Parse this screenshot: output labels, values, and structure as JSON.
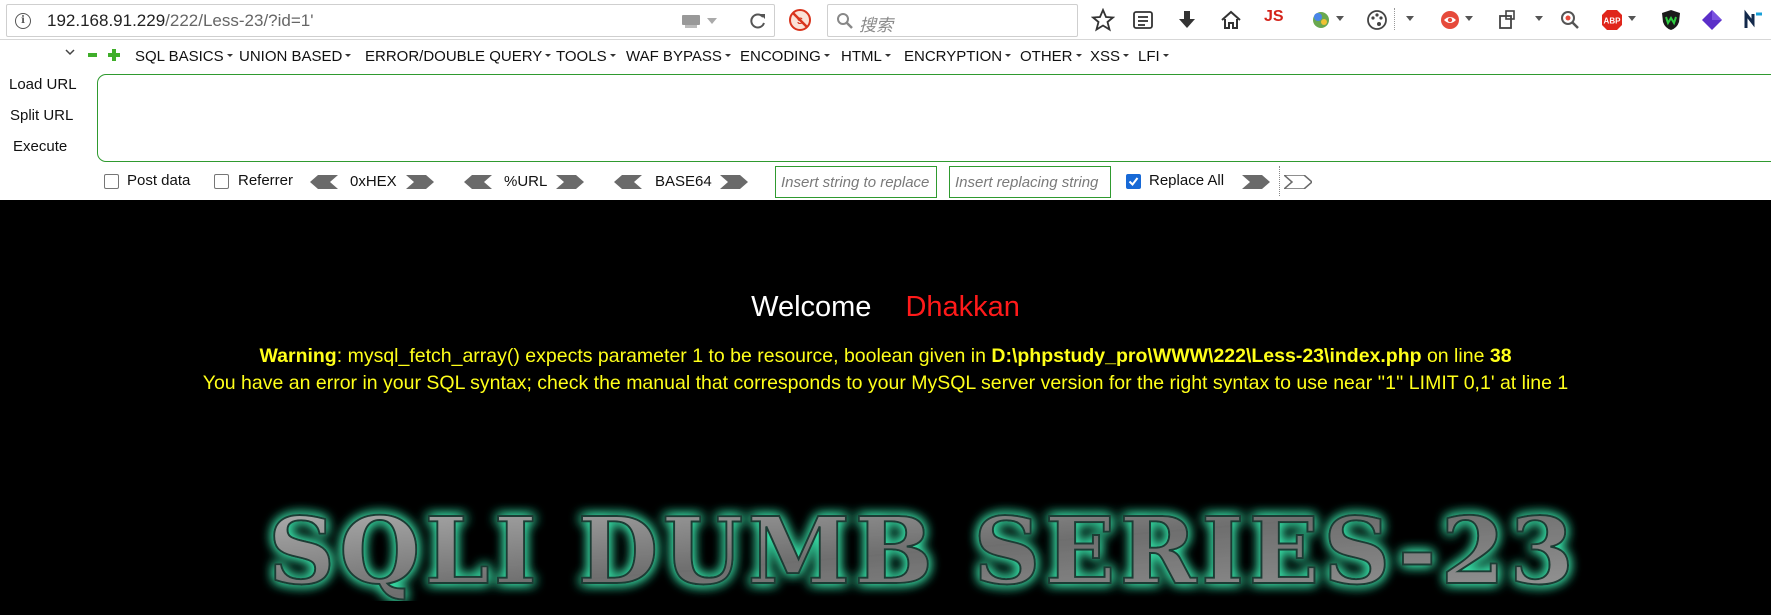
{
  "browser": {
    "url_host": "192.168.91.229",
    "url_path": "/222/Less-23/?id=1'",
    "search_placeholder": "搜索",
    "js_label": "JS",
    "abp_label": "ABP",
    "icons": [
      "info-icon",
      "page-dropdown-icon",
      "reload-icon",
      "noscript-icon",
      "search-icon",
      "bookmark-star-icon",
      "reading-list-icon",
      "download-icon",
      "home-icon",
      "js-switch-icon",
      "color-picker-icon",
      "palette-icon",
      "menu-caret-icon",
      "screenshot-icon",
      "tab-container-icon",
      "zoom-icon",
      "adblock-plus-icon",
      "shield-icon",
      "cube-icon",
      "extension-icon"
    ]
  },
  "hackbar": {
    "menu": [
      "SQL BASICS",
      "UNION BASED",
      "ERROR/DOUBLE QUERY",
      "TOOLS",
      "WAF BYPASS",
      "ENCODING",
      "HTML",
      "ENCRYPTION",
      "OTHER",
      "XSS",
      "LFI"
    ],
    "load_url": "Load URL",
    "split_url": "Split URL",
    "execute": "Execute",
    "url_value": "",
    "post_data": {
      "label": "Post data",
      "checked": false
    },
    "referrer": {
      "label": "Referrer",
      "checked": false
    },
    "hex_label": "0xHEX",
    "url_enc_label": "%URL",
    "base64_label": "BASE64",
    "replace_from_placeholder": "Insert string to replace",
    "replace_to_placeholder": "Insert replacing string",
    "replace_all": {
      "label": "Replace All",
      "checked": true
    },
    "accent_color": "#2f9a2f"
  },
  "page": {
    "welcome": "Welcome",
    "name": "Dhakkan",
    "warning_label": "Warning",
    "warning_text": ": mysql_fetch_array() expects parameter 1 to be resource, boolean given in ",
    "warning_path": "D:\\phpstudy_pro\\WWW\\222\\Less-23\\index.php",
    "warning_online": " on line ",
    "warning_line": "38",
    "sql_error": "You have an error in your SQL syntax; check the manual that corresponds to your MySQL server version for the right syntax to use near ''1'' LIMIT 0,1' at line 1",
    "banner": "SQLI DUMB SERIES-23",
    "colors": {
      "background": "#000000",
      "welcome": "#ffffff",
      "name": "#ff1a1a",
      "message": "#ffff1a",
      "banner_glow": "#39e0a8"
    }
  }
}
